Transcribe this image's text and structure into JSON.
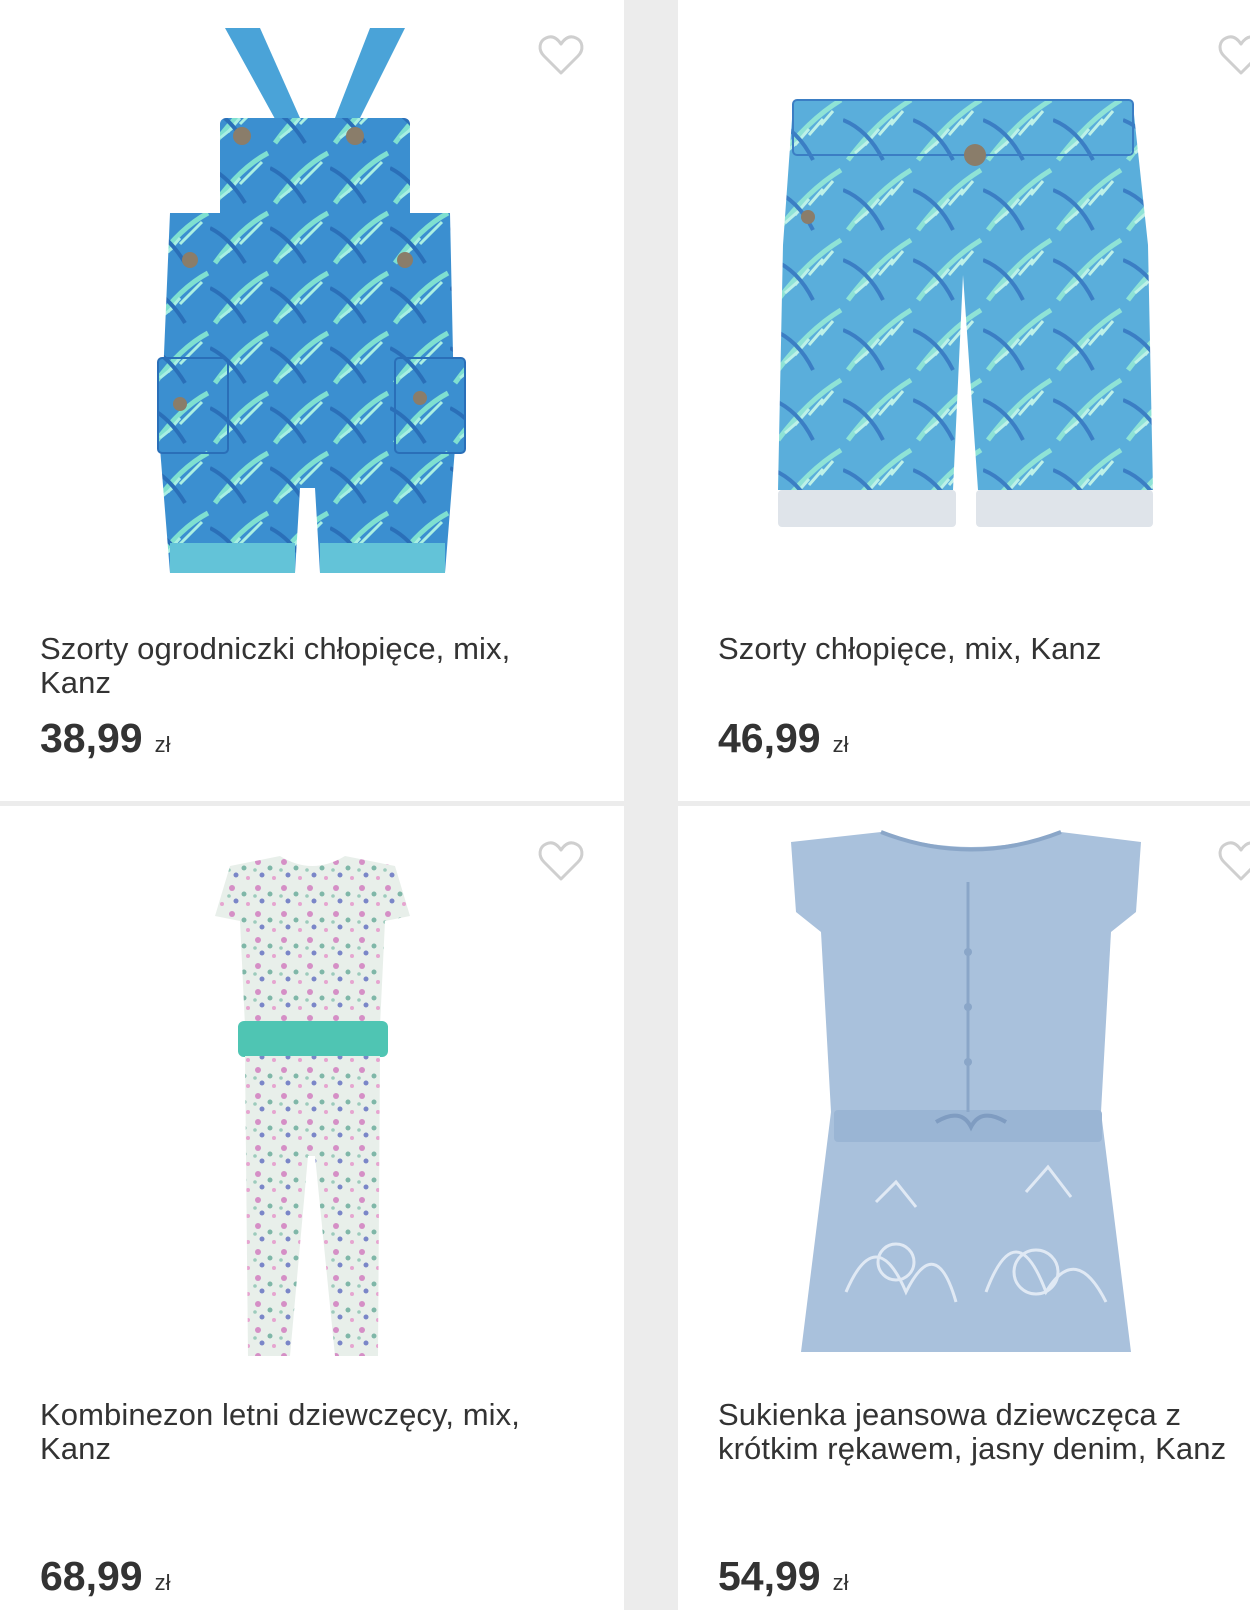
{
  "products": [
    {
      "title": "Szorty ogrodniczki chłopięce, mix, Kanz",
      "price": "38,99",
      "currency": "zł",
      "image": "dungaree-shorts-palm-print",
      "favorite_icon": "heart-outline-icon"
    },
    {
      "title": "Szorty chłopięce, mix, Kanz",
      "price": "46,99",
      "currency": "zł",
      "image": "shorts-palm-print",
      "favorite_icon": "heart-outline-icon"
    },
    {
      "title": "Kombinezon letni dziewczęcy, mix, Kanz",
      "price": "68,99",
      "currency": "zł",
      "image": "floral-jumpsuit",
      "favorite_icon": "heart-outline-icon"
    },
    {
      "title": "Sukienka jeansowa dziewczęca z krótkim rękawem, jasny denim, Kanz",
      "price": "54,99",
      "currency": "zł",
      "image": "light-denim-dress",
      "favorite_icon": "heart-outline-icon"
    }
  ],
  "colors": {
    "background": "#ececec",
    "card": "#ffffff",
    "text": "#333333",
    "heart": "#cfcfcf"
  }
}
